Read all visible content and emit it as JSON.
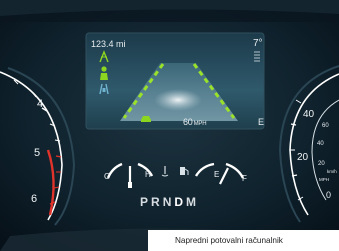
{
  "status": {
    "odometer": "123.4 mi",
    "outside_temp": "7°",
    "set_speed_value": "60",
    "set_speed_unit": "MPH",
    "fuel_range": "E"
  },
  "tachometer": {
    "labels": [
      "4",
      "5",
      "6"
    ]
  },
  "speedometer": {
    "outer_labels": [
      "40",
      "20"
    ],
    "inner_labels": [
      "60",
      "40",
      "20",
      "0"
    ],
    "unit_labels": [
      "MPH",
      "km/h"
    ]
  },
  "gauges": {
    "coolant_cold": "C",
    "coolant_hot": "H",
    "fuel_empty": "E",
    "fuel_full": "F"
  },
  "gear_selector": {
    "gears": [
      "P",
      "R",
      "N",
      "D",
      "M"
    ],
    "selected": "D"
  },
  "caption": {
    "text": "Napredni potovalni računalnik"
  },
  "colors": {
    "accent_green": "#8cd61f",
    "redline": "#e0332b",
    "screen_bg": "#17313f",
    "lane_green": "#9ae22a"
  },
  "icons": [
    "lane-keeping-icon",
    "driver-assist-icon",
    "vehicle-ahead-icon",
    "coolant-temp-icon",
    "fuel-pump-icon",
    "menu-icon"
  ]
}
